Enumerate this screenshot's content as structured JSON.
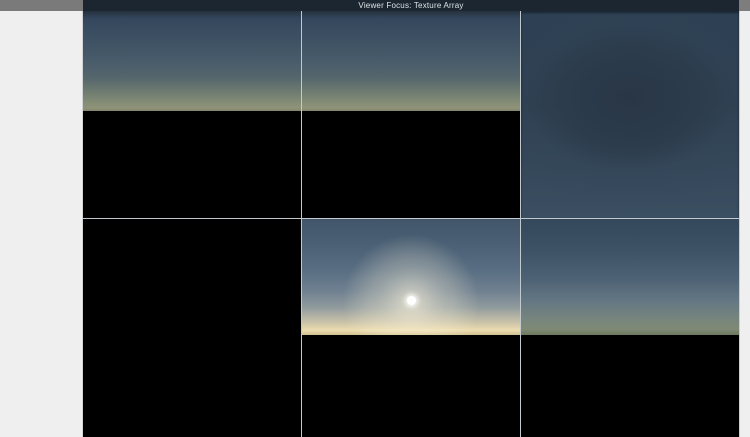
{
  "window": {
    "title": "Viewer Focus: Texture Array"
  },
  "colors": {
    "titlebar_bg": "#1b2631",
    "titlebar_text": "#dde2e7",
    "top_corner_gray": "#7a7a7a",
    "side_panel_bg": "#efefef",
    "viewer_bg": "#000000",
    "grid_divider": "#c4c9cd",
    "day_sky_top": "#33465b",
    "day_horizon_tan": "#8f9278",
    "night_sky": "#2e4154",
    "sunset_horizon_yellow": "#ecdcae",
    "sun": "#ffffff"
  },
  "texture_array": {
    "rows": 2,
    "columns": 3,
    "slices": [
      {
        "index": 0,
        "kind": "sky-horizon-a",
        "description": "hazy blue sky over tan horizon, lower part of cell black"
      },
      {
        "index": 1,
        "kind": "sky-horizon-a",
        "description": "hazy blue sky over tan horizon, lower part of cell black"
      },
      {
        "index": 2,
        "kind": "sky-night",
        "description": "deep blue dusk sky filling entire cell"
      },
      {
        "index": 3,
        "kind": "empty",
        "description": "black empty slice"
      },
      {
        "index": 4,
        "kind": "sky-sun",
        "description": "sun low above warm glowing horizon, lower part of cell black"
      },
      {
        "index": 5,
        "kind": "sky-dusk",
        "description": "dusk blue sky over muted green horizon, lower part of cell black"
      }
    ]
  }
}
